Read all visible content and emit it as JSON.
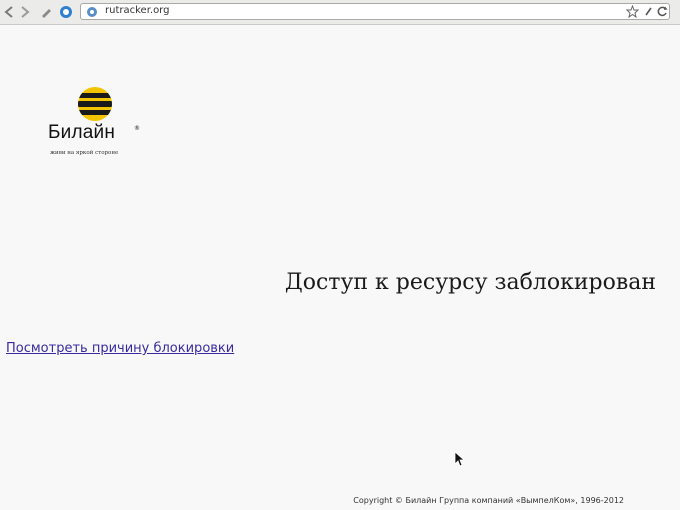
{
  "browser": {
    "url": "rutracker.org"
  },
  "logo": {
    "name": "Билайн",
    "trademark": "®",
    "tagline": "живи на яркой стороне"
  },
  "main": {
    "title": "Доступ к ресурсу заблокирован",
    "reason_link": "Посмотреть причину блокировки"
  },
  "footer": {
    "copyright": "Copyright © Билайн Группа компаний «ВымпелКом», 1996-2012"
  },
  "colors": {
    "brand_yellow": "#f5c400",
    "link": "#3a2aa0"
  },
  "icons": {
    "toolbar": [
      "back-icon",
      "forward-icon",
      "edit-icon",
      "reload-icon"
    ],
    "url_bar": [
      "globe-icon",
      "bookmark-star-icon",
      "clear-icon",
      "refresh-icon"
    ]
  }
}
